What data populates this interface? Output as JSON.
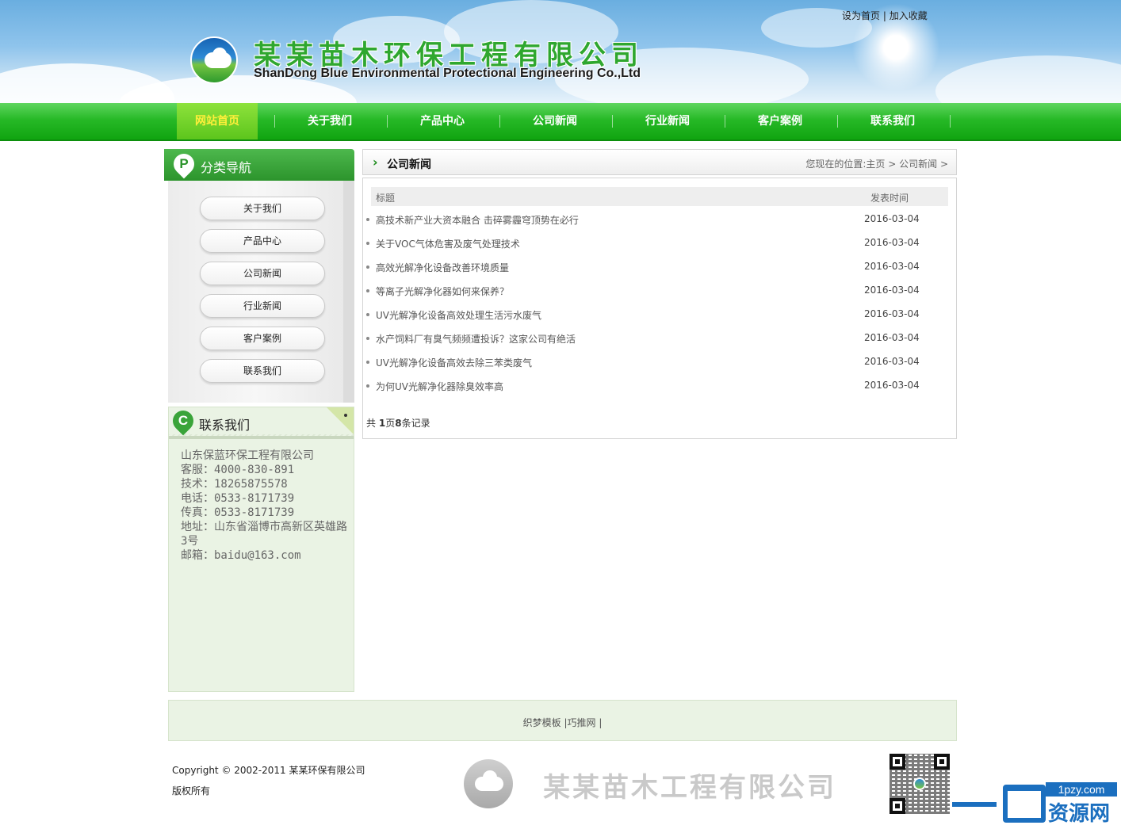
{
  "header": {
    "top_links": {
      "set_home": "设为首页",
      "separator": "|",
      "add_favorite": "加入收藏"
    },
    "logo_cn": "某某苗木环保工程有限公司",
    "logo_en": "ShanDong Blue Environmental Protectional Engineering Co.,Ltd"
  },
  "nav": {
    "items": [
      {
        "label": "网站首页",
        "active": true
      },
      {
        "label": "关于我们",
        "active": false
      },
      {
        "label": "产品中心",
        "active": false
      },
      {
        "label": "公司新闻",
        "active": false
      },
      {
        "label": "行业新闻",
        "active": false
      },
      {
        "label": "客户案例",
        "active": false
      },
      {
        "label": "联系我们",
        "active": false
      }
    ]
  },
  "sidebar": {
    "category": {
      "badge": "P",
      "title": "分类导航",
      "items": [
        "关于我们",
        "产品中心",
        "公司新闻",
        "行业新闻",
        "客户案例",
        "联系我们"
      ]
    },
    "contact": {
      "badge": "C",
      "title": "联系我们",
      "lines": [
        "山东保蓝环保工程有限公司",
        "客服：4000-830-891",
        "技术：18265875578",
        "电话：0533-8171739",
        "传真：0533-8171739",
        "地址：山东省淄博市高新区英雄路3号",
        "邮箱：baidu@163.com"
      ]
    }
  },
  "main": {
    "title": "公司新闻",
    "breadcrumb": {
      "prefix": "您现在的位置:",
      "home": "主页",
      "sep1": " > ",
      "current": "公司新闻",
      "sep2": " >"
    },
    "table": {
      "col_title": "标题",
      "col_date": "发表时间",
      "rows": [
        {
          "title": "高技术新产业大资本融合 击碎雾霾穹顶势在必行",
          "date": "2016-03-04"
        },
        {
          "title": "关于VOC气体危害及废气处理技术",
          "date": "2016-03-04"
        },
        {
          "title": "高效光解净化设备改善环境质量",
          "date": "2016-03-04"
        },
        {
          "title": "等离子光解净化器如何来保养？",
          "date": "2016-03-04"
        },
        {
          "title": "UV光解净化设备高效处理生活污水废气",
          "date": "2016-03-04"
        },
        {
          "title": "水产饲料厂有臭气频频遭投诉？这家公司有绝活",
          "date": "2016-03-04"
        },
        {
          "title": "UV光解净化设备高效去除三苯类废气",
          "date": "2016-03-04"
        },
        {
          "title": "为何UV光解净化器除臭效率高",
          "date": "2016-03-04"
        }
      ]
    },
    "pager": {
      "prefix": "共 ",
      "pages": "1",
      "mid": "页",
      "records": "8",
      "suffix": "条记录"
    }
  },
  "footer": {
    "links": {
      "link1": "织梦模板",
      "sep1": " |",
      "link2": "巧推网",
      "sep2": " |"
    },
    "copyright": "Copyright © 2002-2011 某某环保有限公司",
    "rights": "版权所有",
    "logo_cn": "某某苗木工程有限公司",
    "watermark": {
      "badge": "1pzy.com",
      "text": "资源网"
    }
  }
}
